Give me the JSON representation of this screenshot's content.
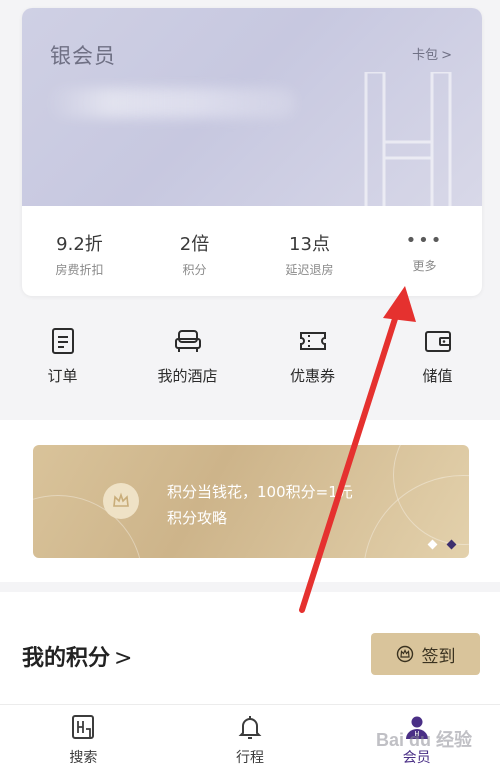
{
  "card": {
    "title": "银会员",
    "link_label": "卡包",
    "link_chevron": ">",
    "stats": [
      {
        "value": "9.2折",
        "label": "房费折扣"
      },
      {
        "value": "2倍",
        "label": "积分"
      },
      {
        "value": "13点",
        "label": "延迟退房"
      },
      {
        "value": "•••",
        "label": "更多"
      }
    ]
  },
  "quick_menu": [
    {
      "label": "订单",
      "icon": "order-icon"
    },
    {
      "label": "我的酒店",
      "icon": "bed-icon"
    },
    {
      "label": "优惠券",
      "icon": "coupon-icon"
    },
    {
      "label": "储值",
      "icon": "wallet-icon"
    }
  ],
  "banner": {
    "line1": "积分当钱花，100积分=1元",
    "line2": "积分攻略",
    "icon": "crown-icon"
  },
  "points": {
    "title": "我的积分",
    "chevron": ">",
    "sign_label": "签到"
  },
  "tabbar": [
    {
      "label": "搜索",
      "icon": "hotel-search-icon"
    },
    {
      "label": "行程",
      "icon": "bell-icon"
    },
    {
      "label": "会员",
      "icon": "member-icon"
    }
  ],
  "watermark": "Bai du 经验",
  "colors": {
    "card_gradient": "#cfd0e4",
    "gold": "#d9c49b",
    "active_tab": "#4a2f86",
    "arrow": "#e5312f"
  }
}
